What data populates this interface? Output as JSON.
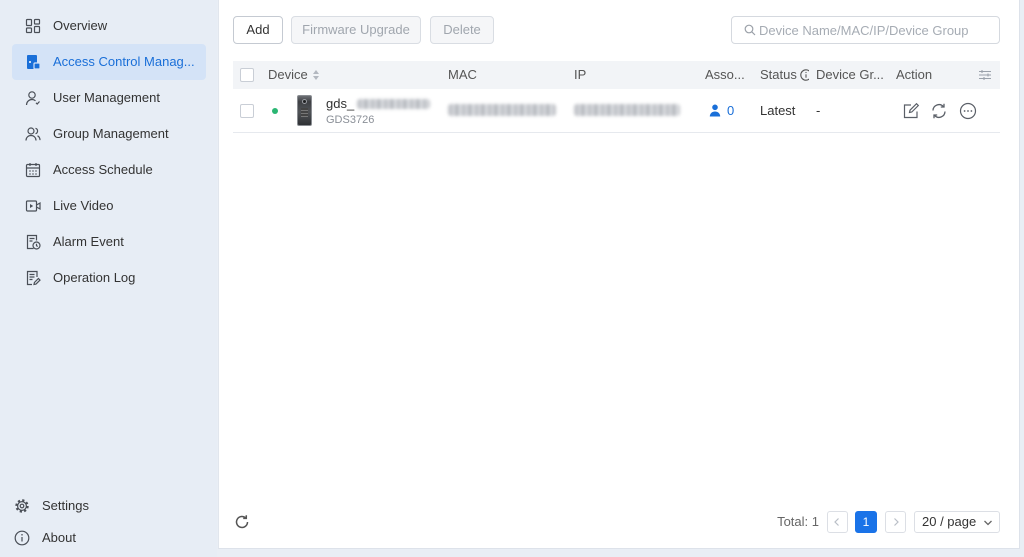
{
  "theme": {
    "accent_color": "#1a73e8",
    "online_color": "#2bb673"
  },
  "sidebar": {
    "items": [
      {
        "label": "Overview",
        "icon": "overview-icon",
        "active": false
      },
      {
        "label": "Access Control Manag...",
        "icon": "access-control-icon",
        "active": true
      },
      {
        "label": "User Management",
        "icon": "user-icon",
        "active": false
      },
      {
        "label": "Group Management",
        "icon": "group-icon",
        "active": false
      },
      {
        "label": "Access Schedule",
        "icon": "calendar-icon",
        "active": false
      },
      {
        "label": "Live Video",
        "icon": "video-icon",
        "active": false
      },
      {
        "label": "Alarm Event",
        "icon": "alarm-event-icon",
        "active": false
      },
      {
        "label": "Operation Log",
        "icon": "operation-log-icon",
        "active": false
      }
    ],
    "footer_items": [
      {
        "label": "Settings",
        "icon": "gear-icon"
      },
      {
        "label": "About",
        "icon": "info-icon"
      }
    ]
  },
  "toolbar": {
    "add_label": "Add",
    "firmware_upgrade_label": "Firmware Upgrade",
    "delete_label": "Delete",
    "search_placeholder": "Device Name/MAC/IP/Device Group",
    "search_value": ""
  },
  "table": {
    "columns": {
      "device": "Device",
      "mac": "MAC",
      "ip": "IP",
      "association": "Asso...",
      "status": "Status",
      "device_group": "Device Gr...",
      "action": "Action"
    },
    "rows": [
      {
        "online_color": "#2bb673",
        "device_name": "gds_",
        "device_model": "GDS3726",
        "association_count": "0",
        "status": "Latest",
        "device_group": "-",
        "actions": [
          "edit-icon",
          "sync-icon",
          "more-icon"
        ]
      }
    ]
  },
  "pagination": {
    "total_label": "Total: 1",
    "current_page": "1",
    "page_size": "20 / page"
  }
}
